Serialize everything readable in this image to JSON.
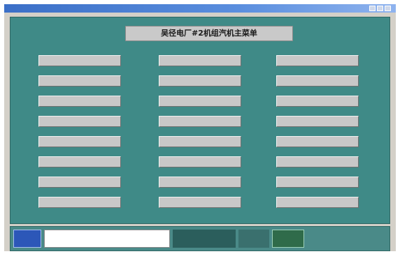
{
  "window": {
    "title": ""
  },
  "main": {
    "header": "吴径电厂#2机组汽机主菜单",
    "columns": [
      {
        "items": [
          "",
          "",
          "",
          "",
          "",
          "",
          "",
          ""
        ]
      },
      {
        "items": [
          "",
          "",
          "",
          "",
          "",
          "",
          "",
          ""
        ]
      },
      {
        "items": [
          "",
          "",
          "",
          "",
          "",
          "",
          "",
          ""
        ]
      }
    ]
  },
  "status_bar": {
    "left_panel": "",
    "right_panel": ""
  },
  "colors": {
    "panel_bg": "#3f8a87",
    "button_bg": "#c8c8c8",
    "title_bar": "#3b6fc7"
  }
}
